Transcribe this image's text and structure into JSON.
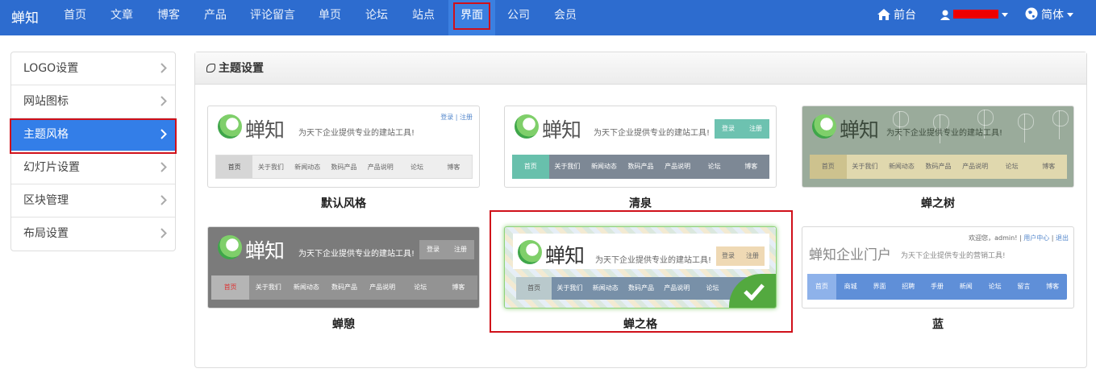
{
  "nav": {
    "brand": "蝉知",
    "items": [
      "首页",
      "文章",
      "博客",
      "产品",
      "评论留言",
      "单页",
      "论坛",
      "站点",
      "界面",
      "公司",
      "会员"
    ],
    "active": "界面",
    "front_label": "前台",
    "lang_label": "简体"
  },
  "sidebar": {
    "items": [
      "LOGO设置",
      "网站图标",
      "主题风格",
      "幻灯片设置",
      "区块管理",
      "布局设置"
    ],
    "active": "主题风格"
  },
  "panel": {
    "title": "主题设置"
  },
  "preview": {
    "logo_text": "蝉知",
    "slogan": "为天下企业提供专业的建站工具!",
    "menu": [
      "首页",
      "关于我们",
      "新闻动态",
      "数码产品",
      "产品说明",
      "论坛",
      "博客"
    ],
    "login": "登录",
    "register": "注册",
    "blue": {
      "title": "蝉知企业门户",
      "slogan": "为天下企业提供专业的营销工具!",
      "welcome": "欢迎您，admin!",
      "user_center": "用户中心",
      "logout": "退出",
      "menu": [
        "首页",
        "商城",
        "界面",
        "招聘",
        "手册",
        "新闻",
        "论坛",
        "留言",
        "博客"
      ]
    }
  },
  "themes": [
    {
      "name": "默认风格",
      "selected": false
    },
    {
      "name": "清泉",
      "selected": false
    },
    {
      "name": "蝉之树",
      "selected": false
    },
    {
      "name": "蝉憩",
      "selected": false
    },
    {
      "name": "蝉之格",
      "selected": true
    },
    {
      "name": "蓝",
      "selected": false
    }
  ],
  "colors": {
    "nav_bg": "#2d6ccf",
    "active_bg": "#337ee8",
    "highlight": "#d0101a",
    "check": "#53a93f"
  }
}
